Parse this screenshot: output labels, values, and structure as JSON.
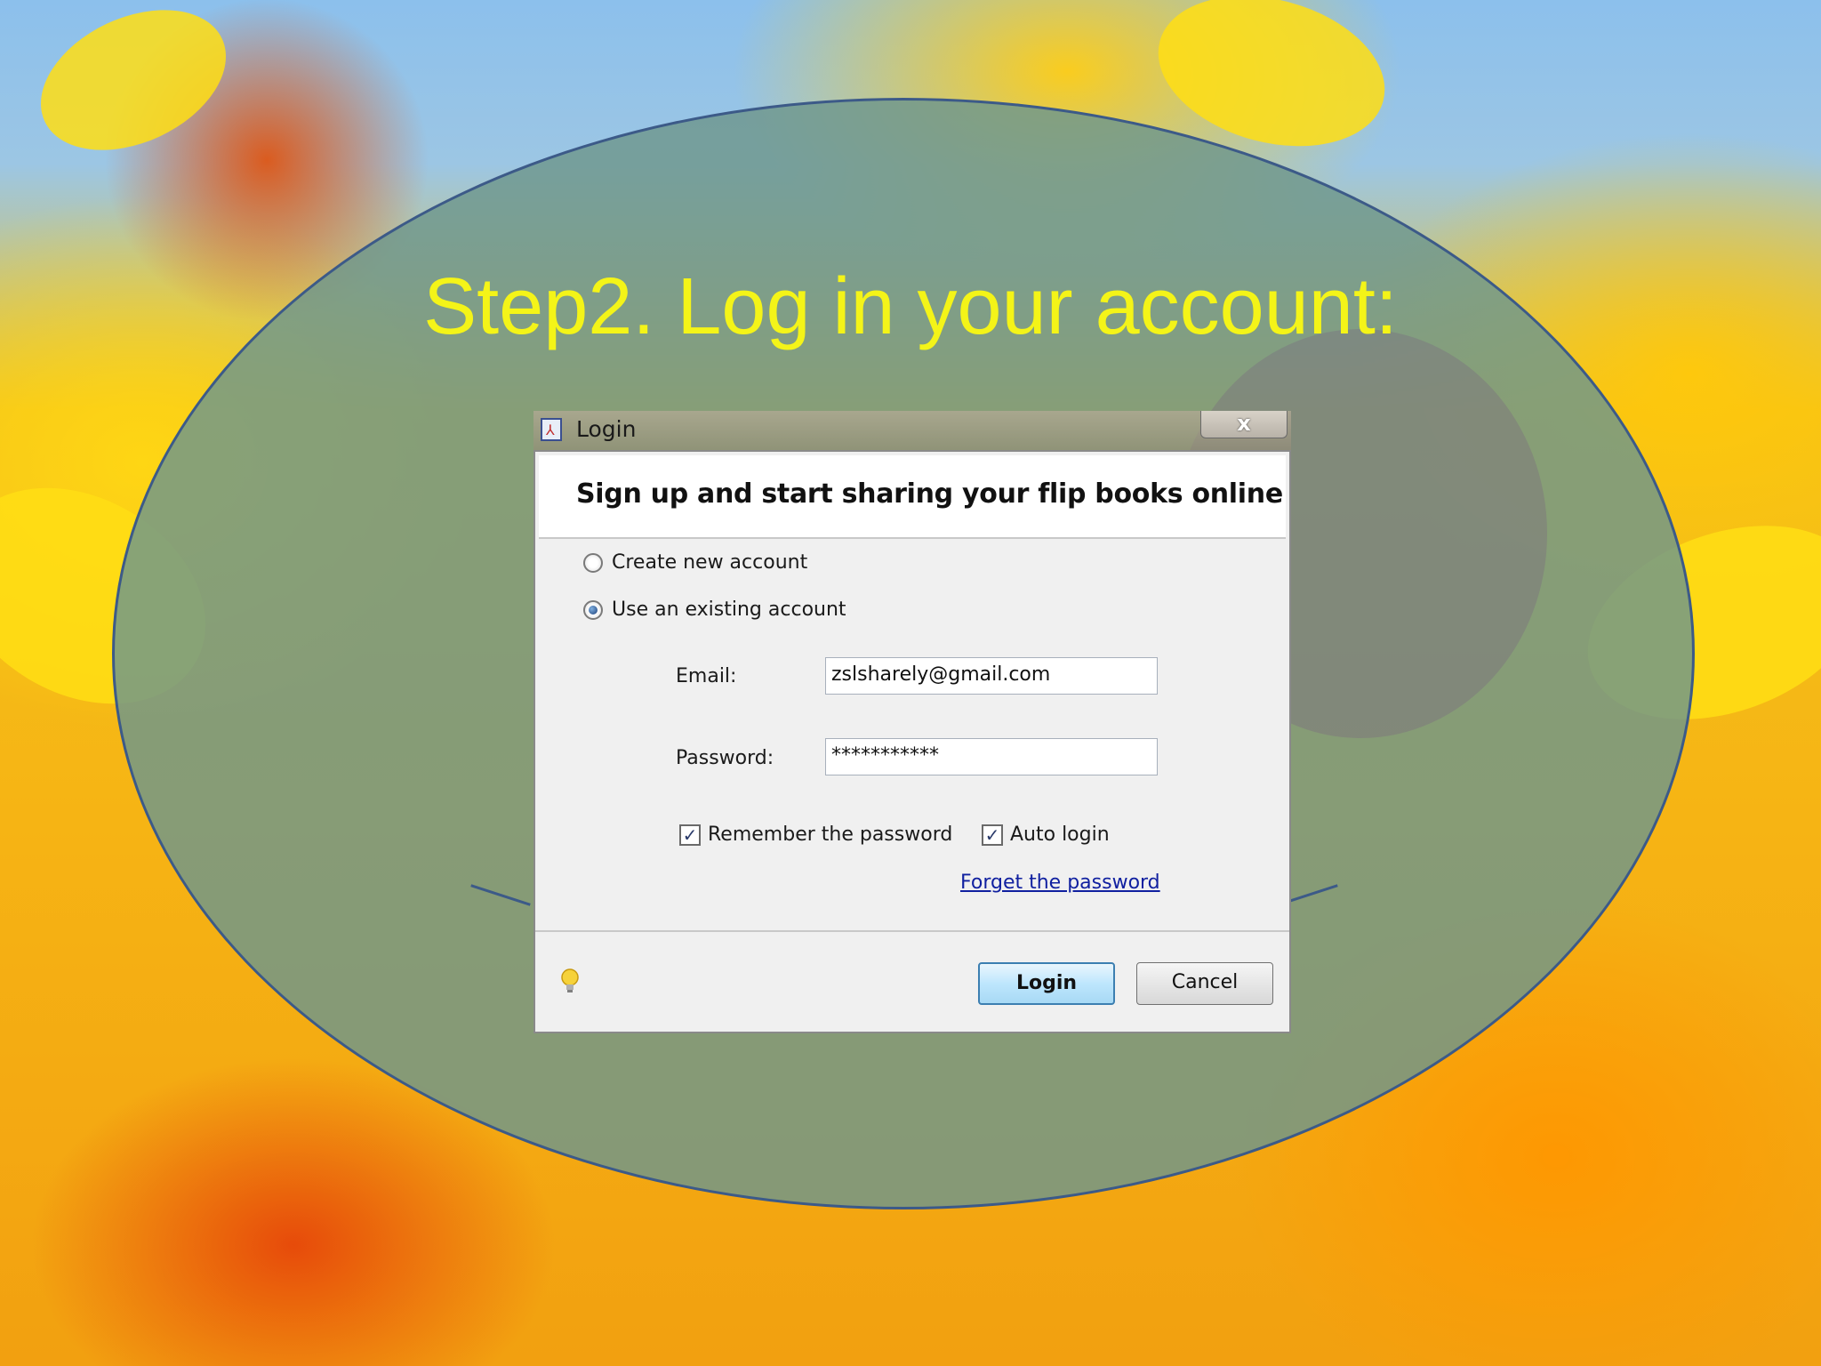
{
  "slide": {
    "title": "Step2. Log in your account:"
  },
  "dialog": {
    "window_title": "Login",
    "close_glyph": "x",
    "heading": "Sign up and start sharing your flip books online",
    "options": {
      "create_label": "Create new account",
      "existing_label": "Use an existing account",
      "selected": "existing"
    },
    "email": {
      "label": "Email:",
      "value": "zslsharely@gmail.com"
    },
    "password": {
      "label": "Password:",
      "value": "***********"
    },
    "remember": {
      "label": "Remember the password",
      "checked": true
    },
    "auto_login": {
      "label": "Auto login",
      "checked": true
    },
    "forget_link": "Forget the password",
    "buttons": {
      "login": "Login",
      "cancel": "Cancel"
    },
    "icons": {
      "app": "flipbook-app-icon",
      "hint": "lightbulb-icon"
    }
  },
  "colors": {
    "title": "#f4f418",
    "oval_border": "#3c5a88",
    "link": "#1020a0",
    "login_border": "#3c7fb1"
  }
}
